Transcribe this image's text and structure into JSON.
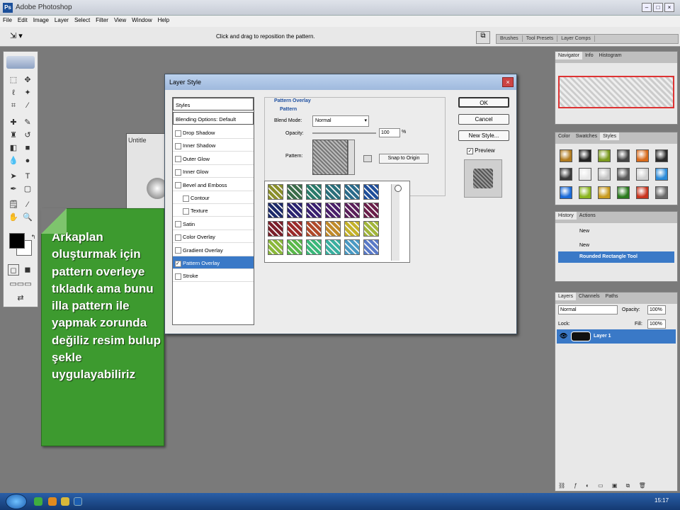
{
  "app": {
    "title": "Adobe Photoshop"
  },
  "menu": [
    "File",
    "Edit",
    "Image",
    "Layer",
    "Select",
    "Filter",
    "View",
    "Window",
    "Help"
  ],
  "options_bar": {
    "message": "Click and drag to reposition the pattern."
  },
  "dock_tabs": [
    "Brushes",
    "Tool Presets",
    "Layer Comps"
  ],
  "document": {
    "title": "Untitle"
  },
  "callout": {
    "text": "Arkaplan oluşturmak için pattern overleye tıkladık ama bunu illa pattern ile yapmak zorunda değiliz resim bulup şekle uygulayabiliriz"
  },
  "dialog": {
    "title": "Layer Style",
    "styles_header": "Styles",
    "blending": "Blending Options: Default",
    "items": [
      {
        "label": "Drop Shadow",
        "checked": false
      },
      {
        "label": "Inner Shadow",
        "checked": false
      },
      {
        "label": "Outer Glow",
        "checked": false
      },
      {
        "label": "Inner Glow",
        "checked": false
      },
      {
        "label": "Bevel and Emboss",
        "checked": false
      },
      {
        "label": "Contour",
        "checked": false
      },
      {
        "label": "Texture",
        "checked": false
      },
      {
        "label": "Satin",
        "checked": false
      },
      {
        "label": "Color Overlay",
        "checked": false
      },
      {
        "label": "Gradient Overlay",
        "checked": false
      },
      {
        "label": "Pattern Overlay",
        "checked": true
      },
      {
        "label": "Stroke",
        "checked": false
      }
    ],
    "section_title": "Pattern Overlay",
    "group_title": "Pattern",
    "blend_mode_label": "Blend Mode:",
    "blend_mode_value": "Normal",
    "opacity_label": "Opacity:",
    "opacity_value": "100",
    "opacity_unit": "%",
    "pattern_label": "Pattern:",
    "snap_button": "Snap to Origin",
    "ok": "OK",
    "cancel": "Cancel",
    "new_style": "New Style...",
    "preview_label": "Preview",
    "preview_checked": true,
    "pattern_colors": [
      [
        "#8a8f2a",
        "#3a6d4a",
        "#2a7a6a",
        "#2a6f7a",
        "#2a6a8a",
        "#1f4f9a"
      ],
      [
        "#1c2a6a",
        "#2a2470",
        "#3a2070",
        "#4a1f6a",
        "#5a1f5a",
        "#6a1f4a"
      ],
      [
        "#7a1f2a",
        "#9a2a2a",
        "#b04a2a",
        "#c08a2a",
        "#c4b22a",
        "#a2b63a"
      ],
      [
        "#8ab83a",
        "#5ab84a",
        "#3ab87a",
        "#3ab0a0",
        "#4a9ac4",
        "#5a7ac8"
      ]
    ]
  },
  "navigator": {
    "tabs": [
      "Navigator",
      "Info",
      "Histogram"
    ]
  },
  "styles_panel": {
    "tabs": [
      "Color",
      "Swatches",
      "Styles"
    ],
    "swatches": [
      [
        "#b07a1e",
        "#222222",
        "#7a9a1e",
        "#444444",
        "#d86a1a",
        "#2a2a2a"
      ],
      [
        "#3a3a3a",
        "#e8e8e8",
        "#c4c4c4",
        "#5a5a5a",
        "#d0d0d0",
        "#2a8ad8"
      ],
      [
        "#1a6ad8",
        "#8ab41e",
        "#c89a1e",
        "#2a7a1e",
        "#c8341e",
        "#6a6a6a"
      ]
    ]
  },
  "history": {
    "tabs": [
      "History",
      "Actions"
    ],
    "items": [
      {
        "label": "New",
        "selected": false
      },
      {
        "label": "New",
        "selected": false
      },
      {
        "label": "Rounded Rectangle Tool",
        "selected": true
      }
    ]
  },
  "layers": {
    "tabs": [
      "Layers",
      "Channels",
      "Paths"
    ],
    "blend": "Normal",
    "opacity_label": "Opacity:",
    "opacity": "100%",
    "lock_label": "Lock:",
    "fill_label": "Fill:",
    "fill": "100%",
    "layer_name": "Layer 1"
  },
  "taskbar": {
    "clock": "15:17"
  }
}
